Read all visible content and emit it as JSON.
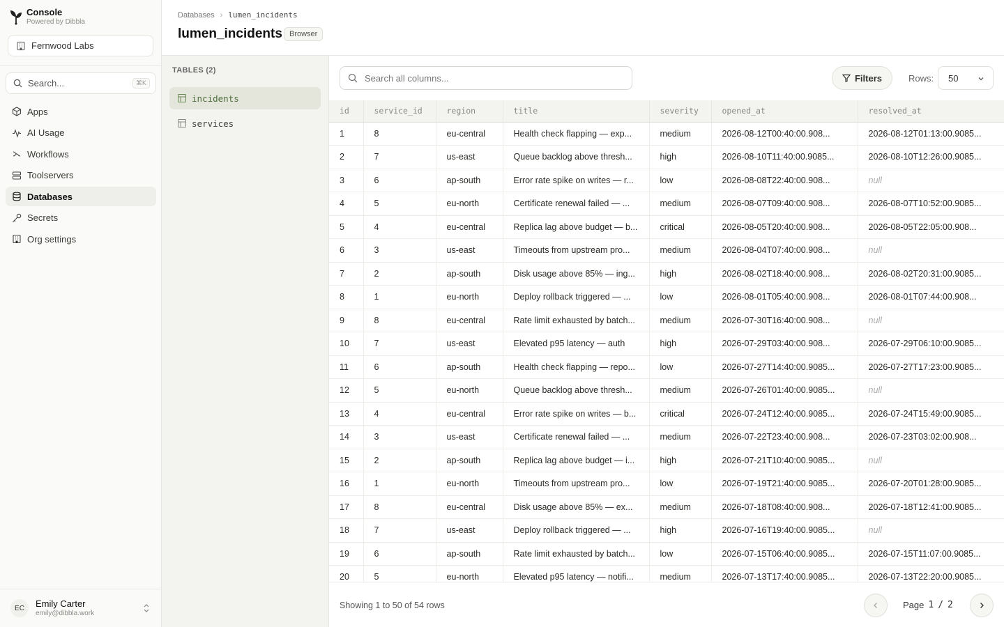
{
  "brand": {
    "title": "Console",
    "subtitle": "Powered by Dibbla"
  },
  "org": {
    "name": "Fernwood Labs"
  },
  "search": {
    "placeholder": "Search...",
    "shortcut": "⌘K"
  },
  "nav": {
    "items": [
      {
        "label": "Apps",
        "icon": "box-icon",
        "active": false
      },
      {
        "label": "AI Usage",
        "icon": "activity-icon",
        "active": false
      },
      {
        "label": "Workflows",
        "icon": "workflow-icon",
        "active": false
      },
      {
        "label": "Toolservers",
        "icon": "server-icon",
        "active": false
      },
      {
        "label": "Databases",
        "icon": "database-icon",
        "active": true
      },
      {
        "label": "Secrets",
        "icon": "key-icon",
        "active": false
      },
      {
        "label": "Org settings",
        "icon": "building-icon",
        "active": false
      }
    ]
  },
  "user": {
    "initials": "EC",
    "name": "Emily Carter",
    "email": "emily@dibbla.work"
  },
  "header": {
    "breadcrumb": [
      "Databases",
      "lumen_incidents"
    ],
    "title": "lumen_incidents",
    "badge": "Browser"
  },
  "tables": {
    "heading": "TABLES (2)",
    "items": [
      {
        "name": "incidents",
        "active": true
      },
      {
        "name": "services",
        "active": false
      }
    ]
  },
  "toolbar": {
    "search_placeholder": "Search all columns...",
    "filters_label": "Filters",
    "rows_label": "Rows:",
    "rows_value": "50"
  },
  "grid": {
    "columns": [
      "id",
      "service_id",
      "region",
      "title",
      "severity",
      "opened_at",
      "resolved_at"
    ],
    "rows": [
      [
        "1",
        "8",
        "eu-central",
        "Health check flapping — exp...",
        "medium",
        "2026-08-12T00:40:00.908...",
        "2026-08-12T01:13:00.9085..."
      ],
      [
        "2",
        "7",
        "us-east",
        "Queue backlog above thresh...",
        "high",
        "2026-08-10T11:40:00.9085...",
        "2026-08-10T12:26:00.9085..."
      ],
      [
        "3",
        "6",
        "ap-south",
        "Error rate spike on writes — r...",
        "low",
        "2026-08-08T22:40:00.908...",
        "null"
      ],
      [
        "4",
        "5",
        "eu-north",
        "Certificate renewal failed — ...",
        "medium",
        "2026-08-07T09:40:00.908...",
        "2026-08-07T10:52:00.9085..."
      ],
      [
        "5",
        "4",
        "eu-central",
        "Replica lag above budget — b...",
        "critical",
        "2026-08-05T20:40:00.908...",
        "2026-08-05T22:05:00.908..."
      ],
      [
        "6",
        "3",
        "us-east",
        "Timeouts from upstream pro...",
        "medium",
        "2026-08-04T07:40:00.908...",
        "null"
      ],
      [
        "7",
        "2",
        "ap-south",
        "Disk usage above 85% — ing...",
        "high",
        "2026-08-02T18:40:00.908...",
        "2026-08-02T20:31:00.9085..."
      ],
      [
        "8",
        "1",
        "eu-north",
        "Deploy rollback triggered — ...",
        "low",
        "2026-08-01T05:40:00.908...",
        "2026-08-01T07:44:00.908..."
      ],
      [
        "9",
        "8",
        "eu-central",
        "Rate limit exhausted by batch...",
        "medium",
        "2026-07-30T16:40:00.908...",
        "null"
      ],
      [
        "10",
        "7",
        "us-east",
        "Elevated p95 latency — auth",
        "high",
        "2026-07-29T03:40:00.908...",
        "2026-07-29T06:10:00.9085..."
      ],
      [
        "11",
        "6",
        "ap-south",
        "Health check flapping — repo...",
        "low",
        "2026-07-27T14:40:00.9085...",
        "2026-07-27T17:23:00.9085..."
      ],
      [
        "12",
        "5",
        "eu-north",
        "Queue backlog above thresh...",
        "medium",
        "2026-07-26T01:40:00.9085...",
        "null"
      ],
      [
        "13",
        "4",
        "eu-central",
        "Error rate spike on writes — b...",
        "critical",
        "2026-07-24T12:40:00.9085...",
        "2026-07-24T15:49:00.9085..."
      ],
      [
        "14",
        "3",
        "us-east",
        "Certificate renewal failed — ...",
        "medium",
        "2026-07-22T23:40:00.908...",
        "2026-07-23T03:02:00.908..."
      ],
      [
        "15",
        "2",
        "ap-south",
        "Replica lag above budget — i...",
        "high",
        "2026-07-21T10:40:00.9085...",
        "null"
      ],
      [
        "16",
        "1",
        "eu-north",
        "Timeouts from upstream pro...",
        "low",
        "2026-07-19T21:40:00.9085...",
        "2026-07-20T01:28:00.9085..."
      ],
      [
        "17",
        "8",
        "eu-central",
        "Disk usage above 85% — ex...",
        "medium",
        "2026-07-18T08:40:00.908...",
        "2026-07-18T12:41:00.9085..."
      ],
      [
        "18",
        "7",
        "us-east",
        "Deploy rollback triggered — ...",
        "high",
        "2026-07-16T19:40:00.9085...",
        "null"
      ],
      [
        "19",
        "6",
        "ap-south",
        "Rate limit exhausted by batch...",
        "low",
        "2026-07-15T06:40:00.9085...",
        "2026-07-15T11:07:00.9085..."
      ],
      [
        "20",
        "5",
        "eu-north",
        "Elevated p95 latency — notifi...",
        "medium",
        "2026-07-13T17:40:00.9085...",
        "2026-07-13T22:20:00.9085..."
      ]
    ]
  },
  "footer": {
    "summary": "Showing 1 to 50 of 54 rows",
    "page_word": "Page",
    "page_current": "1",
    "page_sep": "/",
    "page_total": "2"
  }
}
